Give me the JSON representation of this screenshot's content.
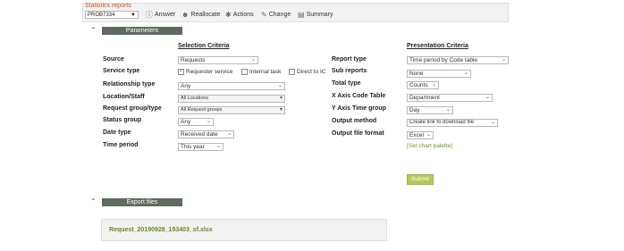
{
  "header": {
    "title": "Statistics reports",
    "problem_select": "PROB7334",
    "buttons": {
      "answer": "Answer",
      "reallocate": "Reallocate",
      "actions": "Actions",
      "change": "Change",
      "summary": "Summary"
    }
  },
  "sections": {
    "parameters": "Parameters",
    "export_files": "Export files"
  },
  "selection": {
    "title": "Selection Criteria",
    "source": {
      "label": "Source",
      "value": "Requests"
    },
    "service_type": {
      "label": "Service type",
      "options": [
        {
          "label": "Requester service",
          "checked": true
        },
        {
          "label": "Internal task",
          "checked": false
        },
        {
          "label": "Direct to IC",
          "checked": false
        }
      ]
    },
    "relationship_type": {
      "label": "Relationship type",
      "value": "Any"
    },
    "location_staff": {
      "label": "Location/Staff",
      "value": "All Locations"
    },
    "request_group": {
      "label": "Request group/type",
      "value": "All Request groups"
    },
    "status_group": {
      "label": "Status group",
      "value": "Any"
    },
    "date_type": {
      "label": "Date type",
      "value": "Received date"
    },
    "time_period": {
      "label": "Time period",
      "value": "This year"
    }
  },
  "middle": {
    "report_type": {
      "label": "Report type"
    },
    "sub_reports": {
      "label": "Sub reports"
    },
    "total_type": {
      "label": "Total type"
    },
    "x_axis": {
      "label": "X Axis Code Table"
    },
    "y_axis": {
      "label": "Y Axis Time group"
    },
    "output_method": {
      "label": "Output method"
    },
    "output_format": {
      "label": "Output file format"
    }
  },
  "presentation": {
    "title": "Presentation Criteria",
    "report_type": "Time period by Code table",
    "sub_reports": "None",
    "total_type": "Counts",
    "x_axis": "Department",
    "y_axis": "Day",
    "output_method": "Create link to download file",
    "output_format": "Excel",
    "chart_palette_link": "[Set chart palette]",
    "submit": "Submit"
  },
  "export": {
    "file": "Request_20190928_153403_sf.xlsx"
  }
}
